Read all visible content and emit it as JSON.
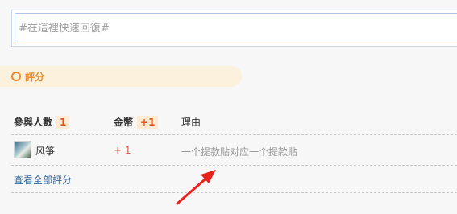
{
  "reply": {
    "placeholder": "#在這裡快速回復#"
  },
  "rating": {
    "title": "評分",
    "columns": {
      "participants_label": "參與人數",
      "participants_count": "1",
      "coins_label": "金幣",
      "coins_total": "+1",
      "reason_label": "理由"
    },
    "rows": [
      {
        "user": "风筝",
        "coins": "+ 1",
        "reason": "一个提款贴对应一个提款贴"
      }
    ],
    "view_all": "查看全部評分"
  },
  "colors": {
    "accent": "#f08a24",
    "banner_bg": "#fcf1dc",
    "link": "#36689c",
    "coin": "#e25a4a",
    "arrow": "#e8231b"
  }
}
